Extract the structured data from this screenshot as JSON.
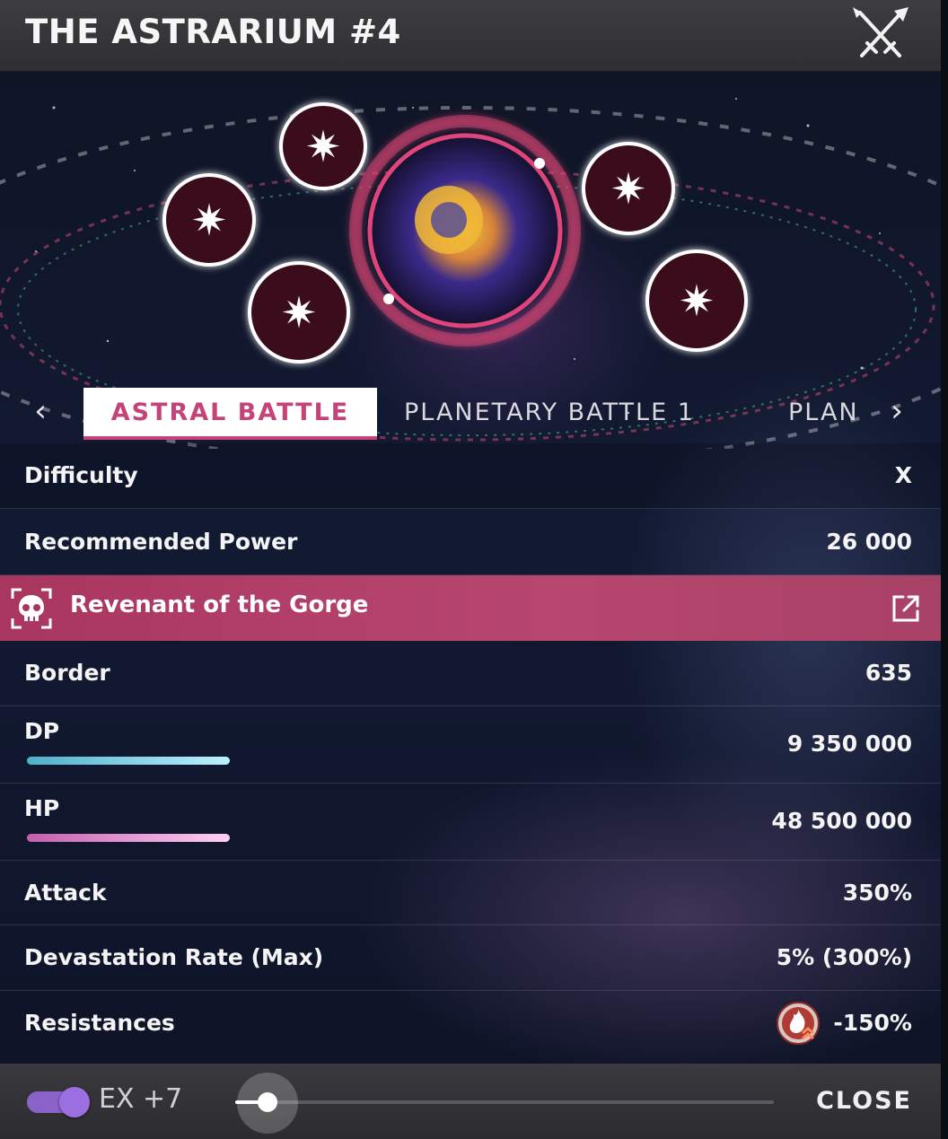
{
  "header": {
    "title": "THE ASTRARIUM #4",
    "icon": "crossed-swords-icon"
  },
  "hero": {
    "nodes": [
      "star-node",
      "star-node",
      "star-node",
      "star-node",
      "star-node"
    ],
    "boss_portrait": "boss-orb"
  },
  "tabs": {
    "prev_icon": "‹",
    "next_icon": "›",
    "items": [
      {
        "label": "ASTRAL BATTLE",
        "active": true
      },
      {
        "label": "PLANETARY BATTLE 1",
        "active": false
      },
      {
        "label": "PLAN",
        "active": false
      }
    ]
  },
  "stats": {
    "difficulty": {
      "label": "Difficulty",
      "value": "X"
    },
    "recommended_power": {
      "label": "Recommended Power",
      "value": "26 000"
    },
    "boss": {
      "name": "Revenant of the Gorge",
      "icon": "skull-icon",
      "link_icon": "external-link-icon"
    },
    "border": {
      "label": "Border",
      "value": "635"
    },
    "dp": {
      "label": "DP",
      "value": "9 350 000",
      "bar_fill": 1.0
    },
    "hp": {
      "label": "HP",
      "value": "48 500 000",
      "bar_fill": 1.0
    },
    "attack": {
      "label": "Attack",
      "value": "350%"
    },
    "devastation": {
      "label": "Devastation Rate (Max)",
      "value": "5% (300%)"
    },
    "resistances": {
      "label": "Resistances",
      "value": "-150%",
      "icon": "fire-element-icon"
    }
  },
  "footer": {
    "toggle_on": true,
    "ex_label": "EX +7",
    "slider_value": 0.06,
    "close_label": "CLOSE"
  },
  "colors": {
    "accent_pink": "#c4447a",
    "boss_row": "#b0406a",
    "toggle": "#8a62c8",
    "dp_bar": "#6fcfe6",
    "hp_bar": "#e08ad0"
  }
}
